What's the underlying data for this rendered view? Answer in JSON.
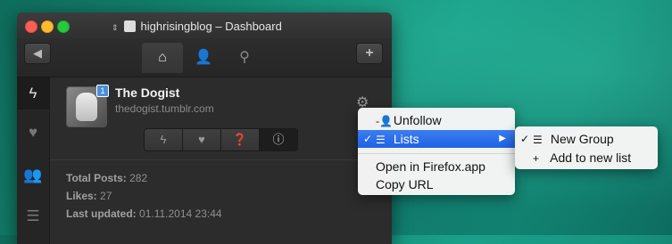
{
  "window": {
    "title": "highrisingblog – Dashboard"
  },
  "toolbar": {
    "back_icon": "◀",
    "add_icon": "+",
    "tabs": [
      {
        "icon": "house-icon",
        "glyph": "⌂"
      },
      {
        "icon": "person-icon",
        "glyph": "👤"
      },
      {
        "icon": "search-icon",
        "glyph": "⚲"
      }
    ]
  },
  "sidebar": [
    {
      "icon": "lightning-icon",
      "glyph": "ϟ"
    },
    {
      "icon": "heart-icon",
      "glyph": "♥"
    },
    {
      "icon": "people-icon",
      "glyph": "👥"
    },
    {
      "icon": "list-icon",
      "glyph": "☰"
    }
  ],
  "blog": {
    "name": "The Dogist",
    "url": "thedogist.tumblr.com",
    "badge": "1",
    "gear_icon": "⚙",
    "segments": [
      {
        "icon": "lightning-icon",
        "glyph": "ϟ"
      },
      {
        "icon": "heart-icon",
        "glyph": "♥"
      },
      {
        "icon": "chat-icon",
        "glyph": "❓"
      },
      {
        "icon": "info-icon",
        "glyph": "ⓘ"
      }
    ]
  },
  "stats": {
    "total_posts_label": "Total Posts:",
    "total_posts_value": "282",
    "likes_label": "Likes:",
    "likes_value": "27",
    "last_updated_label": "Last updated:",
    "last_updated_value": "01.11.2014 23:44"
  },
  "context_menu": {
    "unfollow": {
      "icon": "-👤",
      "label": "Unfollow"
    },
    "lists": {
      "check": "✓",
      "icon": "☰",
      "label": "Lists",
      "arrow": "▶"
    },
    "open_in_firefox": "Open in Firefox.app",
    "copy_url": "Copy URL"
  },
  "submenu": {
    "new_group": {
      "check": "✓",
      "icon": "☰",
      "label": "New Group"
    },
    "add_to_new_list": {
      "icon": "+",
      "label": "Add to new list"
    }
  }
}
